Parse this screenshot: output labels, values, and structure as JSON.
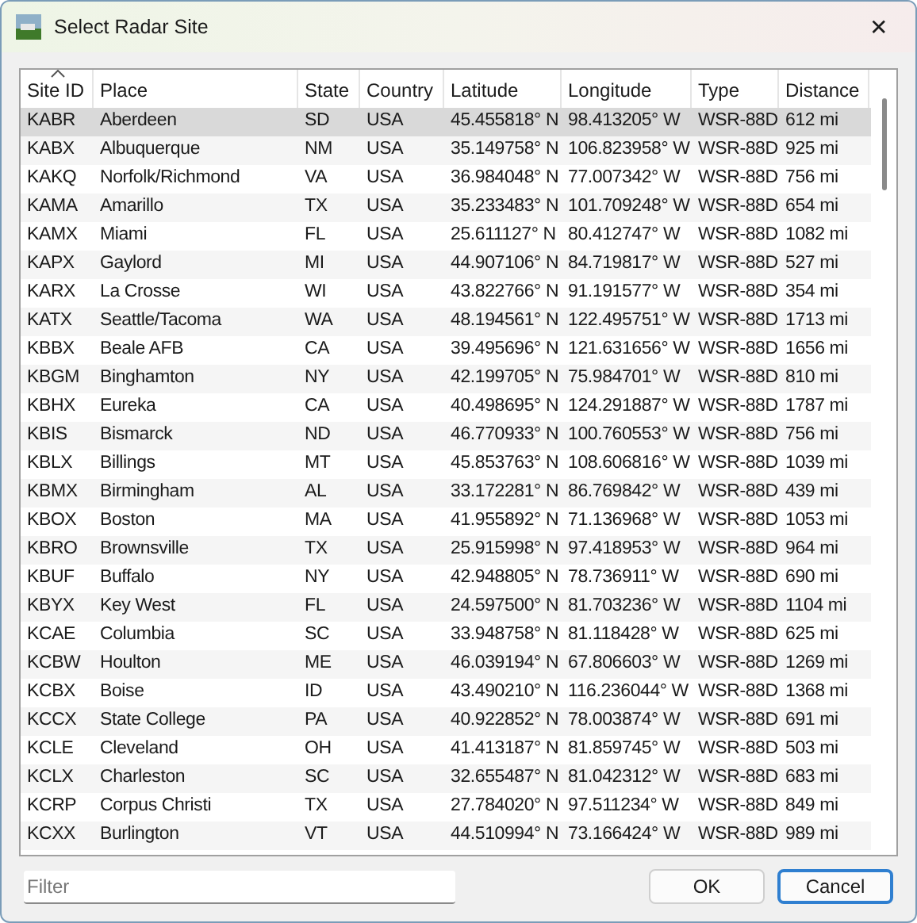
{
  "window": {
    "title": "Select Radar Site",
    "close": "✕"
  },
  "table": {
    "columns": [
      {
        "label": "Site ID",
        "sorted": true
      },
      {
        "label": "Place",
        "sorted": false
      },
      {
        "label": "State",
        "sorted": false
      },
      {
        "label": "Country",
        "sorted": false
      },
      {
        "label": "Latitude",
        "sorted": false
      },
      {
        "label": "Longitude",
        "sorted": false
      },
      {
        "label": "Type",
        "sorted": false
      },
      {
        "label": "Distance",
        "sorted": false
      }
    ],
    "rows": [
      {
        "selected": true,
        "cells": [
          "KABR",
          "Aberdeen",
          "SD",
          "USA",
          "45.455818° N",
          "98.413205° W",
          "WSR-88D",
          "612 mi"
        ]
      },
      {
        "selected": false,
        "cells": [
          "KABX",
          "Albuquerque",
          "NM",
          "USA",
          "35.149758° N",
          "106.823958° W",
          "WSR-88D",
          "925 mi"
        ]
      },
      {
        "selected": false,
        "cells": [
          "KAKQ",
          "Norfolk/Richmond",
          "VA",
          "USA",
          "36.984048° N",
          "77.007342° W",
          "WSR-88D",
          "756 mi"
        ]
      },
      {
        "selected": false,
        "cells": [
          "KAMA",
          "Amarillo",
          "TX",
          "USA",
          "35.233483° N",
          "101.709248° W",
          "WSR-88D",
          "654 mi"
        ]
      },
      {
        "selected": false,
        "cells": [
          "KAMX",
          "Miami",
          "FL",
          "USA",
          "25.611127° N",
          "80.412747° W",
          "WSR-88D",
          "1082 mi"
        ]
      },
      {
        "selected": false,
        "cells": [
          "KAPX",
          "Gaylord",
          "MI",
          "USA",
          "44.907106° N",
          "84.719817° W",
          "WSR-88D",
          "527 mi"
        ]
      },
      {
        "selected": false,
        "cells": [
          "KARX",
          "La Crosse",
          "WI",
          "USA",
          "43.822766° N",
          "91.191577° W",
          "WSR-88D",
          "354 mi"
        ]
      },
      {
        "selected": false,
        "cells": [
          "KATX",
          "Seattle/Tacoma",
          "WA",
          "USA",
          "48.194561° N",
          "122.495751° W",
          "WSR-88D",
          "1713 mi"
        ]
      },
      {
        "selected": false,
        "cells": [
          "KBBX",
          "Beale AFB",
          "CA",
          "USA",
          "39.495696° N",
          "121.631656° W",
          "WSR-88D",
          "1656 mi"
        ]
      },
      {
        "selected": false,
        "cells": [
          "KBGM",
          "Binghamton",
          "NY",
          "USA",
          "42.199705° N",
          "75.984701° W",
          "WSR-88D",
          "810 mi"
        ]
      },
      {
        "selected": false,
        "cells": [
          "KBHX",
          "Eureka",
          "CA",
          "USA",
          "40.498695° N",
          "124.291887° W",
          "WSR-88D",
          "1787 mi"
        ]
      },
      {
        "selected": false,
        "cells": [
          "KBIS",
          "Bismarck",
          "ND",
          "USA",
          "46.770933° N",
          "100.760553° W",
          "WSR-88D",
          "756 mi"
        ]
      },
      {
        "selected": false,
        "cells": [
          "KBLX",
          "Billings",
          "MT",
          "USA",
          "45.853763° N",
          "108.606816° W",
          "WSR-88D",
          "1039 mi"
        ]
      },
      {
        "selected": false,
        "cells": [
          "KBMX",
          "Birmingham",
          "AL",
          "USA",
          "33.172281° N",
          "86.769842° W",
          "WSR-88D",
          "439 mi"
        ]
      },
      {
        "selected": false,
        "cells": [
          "KBOX",
          "Boston",
          "MA",
          "USA",
          "41.955892° N",
          "71.136968° W",
          "WSR-88D",
          "1053 mi"
        ]
      },
      {
        "selected": false,
        "cells": [
          "KBRO",
          "Brownsville",
          "TX",
          "USA",
          "25.915998° N",
          "97.418953° W",
          "WSR-88D",
          "964 mi"
        ]
      },
      {
        "selected": false,
        "cells": [
          "KBUF",
          "Buffalo",
          "NY",
          "USA",
          "42.948805° N",
          "78.736911° W",
          "WSR-88D",
          "690 mi"
        ]
      },
      {
        "selected": false,
        "cells": [
          "KBYX",
          "Key West",
          "FL",
          "USA",
          "24.597500° N",
          "81.703236° W",
          "WSR-88D",
          "1104 mi"
        ]
      },
      {
        "selected": false,
        "cells": [
          "KCAE",
          "Columbia",
          "SC",
          "USA",
          "33.948758° N",
          "81.118428° W",
          "WSR-88D",
          "625 mi"
        ]
      },
      {
        "selected": false,
        "cells": [
          "KCBW",
          "Houlton",
          "ME",
          "USA",
          "46.039194° N",
          "67.806603° W",
          "WSR-88D",
          "1269 mi"
        ]
      },
      {
        "selected": false,
        "cells": [
          "KCBX",
          "Boise",
          "ID",
          "USA",
          "43.490210° N",
          "116.236044° W",
          "WSR-88D",
          "1368 mi"
        ]
      },
      {
        "selected": false,
        "cells": [
          "KCCX",
          "State College",
          "PA",
          "USA",
          "40.922852° N",
          "78.003874° W",
          "WSR-88D",
          "691 mi"
        ]
      },
      {
        "selected": false,
        "cells": [
          "KCLE",
          "Cleveland",
          "OH",
          "USA",
          "41.413187° N",
          "81.859745° W",
          "WSR-88D",
          "503 mi"
        ]
      },
      {
        "selected": false,
        "cells": [
          "KCLX",
          "Charleston",
          "SC",
          "USA",
          "32.655487° N",
          "81.042312° W",
          "WSR-88D",
          "683 mi"
        ]
      },
      {
        "selected": false,
        "cells": [
          "KCRP",
          "Corpus Christi",
          "TX",
          "USA",
          "27.784020° N",
          "97.511234° W",
          "WSR-88D",
          "849 mi"
        ]
      },
      {
        "selected": false,
        "cells": [
          "KCXX",
          "Burlington",
          "VT",
          "USA",
          "44.510994° N",
          "73.166424° W",
          "WSR-88D",
          "989 mi"
        ]
      }
    ]
  },
  "filter": {
    "placeholder": "Filter"
  },
  "buttons": [
    {
      "label": "OK",
      "default": false
    },
    {
      "label": "Cancel",
      "default": true
    }
  ]
}
